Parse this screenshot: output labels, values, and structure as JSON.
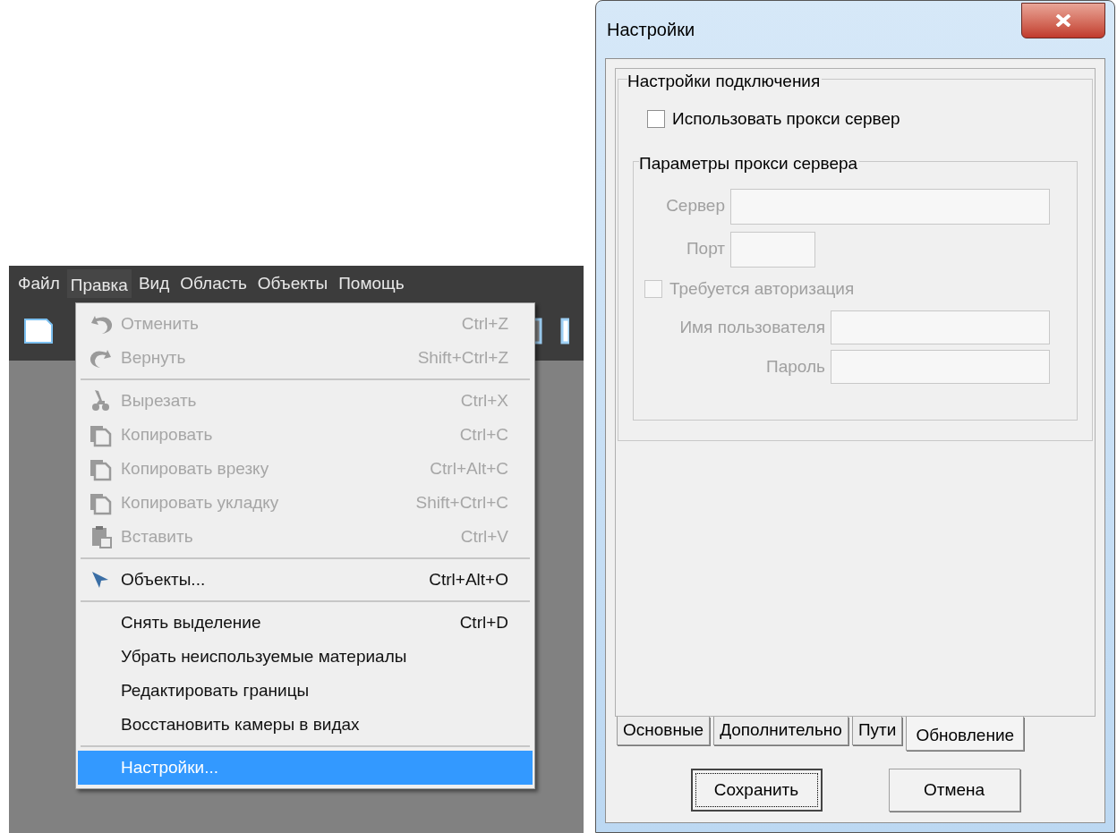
{
  "app": {
    "menu_bar": [
      {
        "label": "Файл",
        "selected": false
      },
      {
        "label": "Правка",
        "selected": true
      },
      {
        "label": "Вид",
        "selected": false
      },
      {
        "label": "Область",
        "selected": false
      },
      {
        "label": "Объекты",
        "selected": false
      },
      {
        "label": "Помощь",
        "selected": false
      }
    ],
    "menu": {
      "sections": [
        {
          "items": [
            {
              "label": "Отменить",
              "shortcut": "Ctrl+Z",
              "disabled": true,
              "selected": false
            },
            {
              "label": "Вернуть",
              "shortcut": "Shift+Ctrl+Z",
              "disabled": true,
              "selected": false
            }
          ]
        },
        {
          "items": [
            {
              "label": "Вырезать",
              "shortcut": "Ctrl+X",
              "disabled": true,
              "selected": false
            },
            {
              "label": "Копировать",
              "shortcut": "Ctrl+C",
              "disabled": true,
              "selected": false
            },
            {
              "label": "Копировать врезку",
              "shortcut": "Ctrl+Alt+C",
              "disabled": true,
              "selected": false
            },
            {
              "label": "Копировать укладку",
              "shortcut": "Shift+Ctrl+C",
              "disabled": true,
              "selected": false
            },
            {
              "label": "Вставить",
              "shortcut": "Ctrl+V",
              "disabled": true,
              "selected": false
            }
          ]
        },
        {
          "items": [
            {
              "label": "Объекты...",
              "shortcut": "Ctrl+Alt+O",
              "disabled": false,
              "selected": false
            }
          ]
        },
        {
          "items": [
            {
              "label": "Снять выделение",
              "shortcut": "Ctrl+D",
              "disabled": false,
              "selected": false
            },
            {
              "label": "Убрать неиспользуемые материалы",
              "disabled": false,
              "selected": false
            },
            {
              "label": "Редактировать границы",
              "disabled": false,
              "selected": false
            },
            {
              "label": "Восстановить камеры в видах",
              "disabled": false,
              "selected": false
            }
          ]
        },
        {
          "items": [
            {
              "label": "Настройки...",
              "disabled": false,
              "selected": true
            }
          ]
        }
      ]
    }
  },
  "dialog": {
    "title": "Настройки",
    "connection": {
      "legend": "Настройки подключения",
      "use_proxy": {
        "label": "Использовать прокси сервер",
        "checked": false
      },
      "proxy_params": {
        "legend": "Параметры прокси сервера",
        "disabled": true,
        "server_fields": [
          {
            "label": "Сервер"
          },
          {
            "label": "Порт"
          }
        ],
        "auth": {
          "label": "Требуется авторизация",
          "checked": false
        },
        "auth_fields": [
          {
            "label": "Имя пользователя"
          },
          {
            "label": "Пароль"
          }
        ]
      }
    },
    "tabs": [
      {
        "label": "Основные",
        "selected": false
      },
      {
        "label": "Дополнительно",
        "selected": false
      },
      {
        "label": "Пути",
        "selected": false
      },
      {
        "label": "Обновление",
        "selected": true
      }
    ],
    "buttons": [
      {
        "label": "Сохранить",
        "focused": true
      },
      {
        "label": "Отмена",
        "focused": false
      }
    ]
  }
}
